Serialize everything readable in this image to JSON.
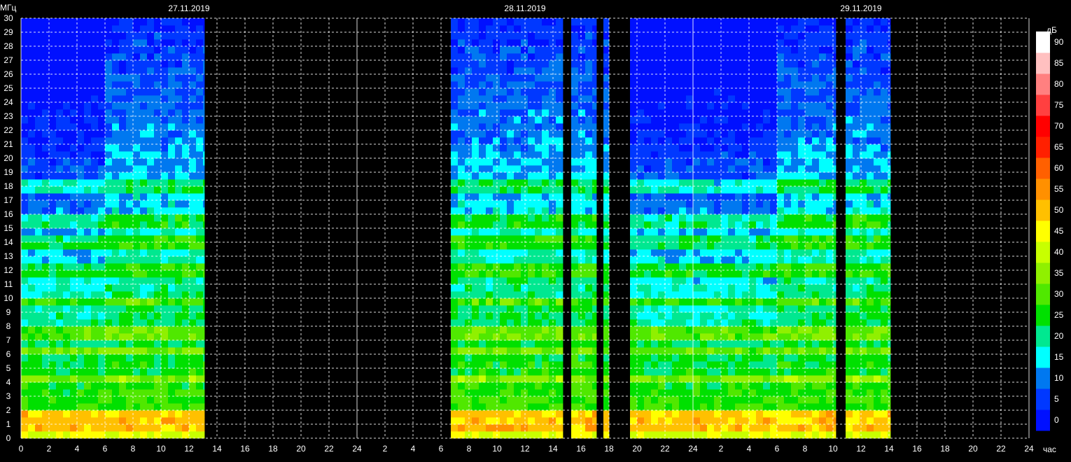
{
  "chart_data": {
    "type": "heatmap",
    "title": "",
    "ylabel": "МГц",
    "xlabel": "час",
    "colorbar_label": "дБ",
    "y_ticks": [
      0,
      1,
      2,
      3,
      4,
      5,
      6,
      7,
      8,
      9,
      10,
      11,
      12,
      13,
      14,
      15,
      16,
      17,
      18,
      19,
      20,
      21,
      22,
      23,
      24,
      25,
      26,
      27,
      28,
      29,
      30
    ],
    "ylim": [
      0,
      30
    ],
    "x_tick_labels": [
      "0",
      "2",
      "4",
      "6",
      "8",
      "10",
      "12",
      "14",
      "16",
      "18",
      "20",
      "22",
      "24",
      "2",
      "4",
      "6",
      "8",
      "10",
      "12",
      "14",
      "16",
      "18",
      "20",
      "22",
      "24",
      "2",
      "4",
      "6",
      "8",
      "10",
      "12",
      "14",
      "16",
      "18",
      "20",
      "22",
      "24"
    ],
    "xlim_hours": [
      0,
      72
    ],
    "date_labels": [
      {
        "text": "27.11.2019",
        "hour": 12
      },
      {
        "text": "28.11.2019",
        "hour": 36
      },
      {
        "text": "29.11.2019",
        "hour": 60
      }
    ],
    "colorbar": {
      "ticks": [
        0,
        5,
        10,
        15,
        20,
        25,
        30,
        35,
        40,
        45,
        50,
        55,
        60,
        65,
        70,
        75,
        80,
        85,
        90
      ],
      "colors": [
        "#0010ff",
        "#0038ff",
        "#0078f0",
        "#00ffff",
        "#00e890",
        "#00e000",
        "#50e800",
        "#90f000",
        "#c8ff00",
        "#ffff00",
        "#ffc000",
        "#ff9000",
        "#ff6000",
        "#ff2000",
        "#ff0000",
        "#ff4040",
        "#ff8080",
        "#ffc0c0",
        "#ffffff"
      ]
    },
    "data_segments_hours": [
      [
        0.0,
        13.1
      ],
      [
        30.7,
        38.7
      ],
      [
        39.3,
        41.1
      ],
      [
        41.6,
        42.0
      ],
      [
        43.5,
        58.2
      ],
      [
        58.9,
        62.1
      ]
    ],
    "strong_bands_mhz": [
      0.5,
      1.3,
      4.0,
      6.1,
      7.3,
      9.6,
      11.8,
      13.7,
      15.3,
      17.7
    ]
  }
}
